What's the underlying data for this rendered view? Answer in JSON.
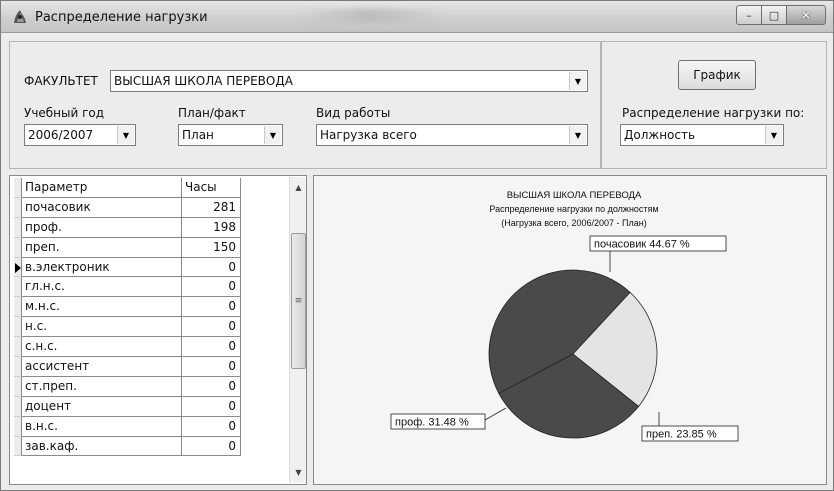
{
  "window": {
    "title": "Распределение нагрузки",
    "min_label": "–",
    "max_label": "□",
    "close_label": "✕"
  },
  "filters": {
    "faculty_label": "ФАКУЛЬТЕТ",
    "faculty_value": "ВЫСШАЯ ШКОЛА ПЕРЕВОДА",
    "year_label": "Учебный год",
    "year_value": "2006/2007",
    "plan_label": "План/факт",
    "plan_value": "План",
    "work_label": "Вид работы",
    "work_value": "Нагрузка всего",
    "chart_button": "График",
    "distribution_label": "Распределение нагрузки по:",
    "distribution_value": "Должность"
  },
  "grid": {
    "headers": [
      "Параметр",
      "Часы"
    ],
    "rows": [
      {
        "param": "почасовик",
        "hours": "281"
      },
      {
        "param": "проф.",
        "hours": "198"
      },
      {
        "param": "преп.",
        "hours": "150"
      },
      {
        "param": "в.электроник",
        "hours": "0"
      },
      {
        "param": "гл.н.с.",
        "hours": "0"
      },
      {
        "param": "м.н.с.",
        "hours": "0"
      },
      {
        "param": "н.с.",
        "hours": "0"
      },
      {
        "param": "с.н.с.",
        "hours": "0"
      },
      {
        "param": "ассистент",
        "hours": "0"
      },
      {
        "param": "ст.преп.",
        "hours": "0"
      },
      {
        "param": "доцент",
        "hours": "0"
      },
      {
        "param": "в.н.с.",
        "hours": "0"
      },
      {
        "param": "зав.каф.",
        "hours": "0"
      }
    ],
    "selected_row": 3
  },
  "chart_data": {
    "type": "pie",
    "title": "ВЫСШАЯ ШКОЛА ПЕРЕВОДА",
    "subtitle": "Распределение нагрузки по должностям",
    "subtitle2": "(Нагрузка всего, 2006/2007 - План)",
    "slices": [
      {
        "label": "почасовик 44.67 %",
        "value": 44.67,
        "color": "#4a4a4a"
      },
      {
        "label": "преп. 23.85 %",
        "value": 23.85,
        "color": "#e4e4e4"
      },
      {
        "label": "проф. 31.48 %",
        "value": 31.48,
        "color": "#4a4a4a"
      }
    ]
  }
}
